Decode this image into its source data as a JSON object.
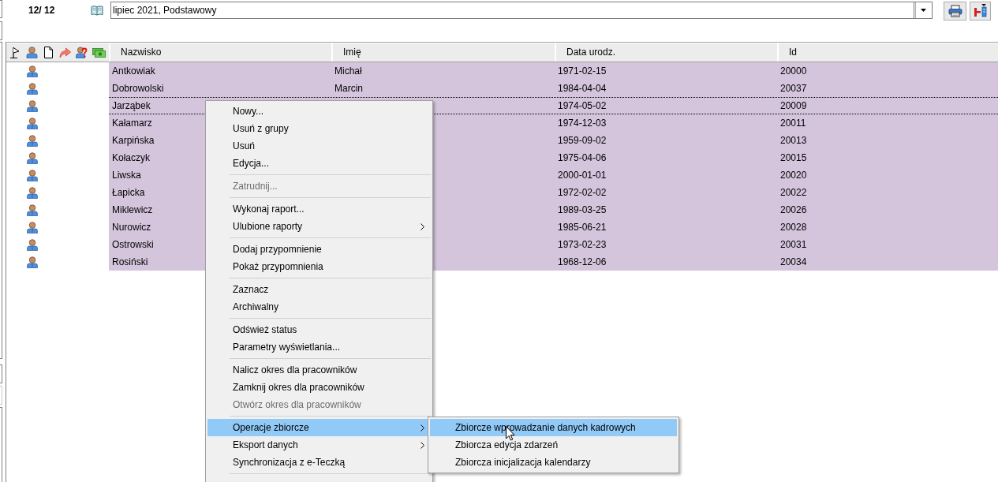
{
  "toolbar": {
    "counter": "12/ 12",
    "period": {
      "value": "lipiec 2021, Podstawowy"
    }
  },
  "table": {
    "columns": [
      "Nazwisko",
      "Imię",
      "Data urodz.",
      "Id"
    ],
    "rows": [
      {
        "last_name": "Antkowiak",
        "first_name": "Michał",
        "birth_date": "1971-02-15",
        "id": "20000",
        "selected": true,
        "focused": false
      },
      {
        "last_name": "Dobrowolski",
        "first_name": "Marcin",
        "birth_date": "1984-04-04",
        "id": "20037",
        "selected": true,
        "focused": false
      },
      {
        "last_name": "Jarząbek",
        "birth_date": "1974-05-02",
        "id": "20009",
        "selected": true,
        "focused": true
      },
      {
        "last_name": "Kałamarz",
        "birth_date": "1974-12-03",
        "id": "20011",
        "selected": true,
        "focused": false
      },
      {
        "last_name": "Karpińska",
        "birth_date": "1959-09-02",
        "id": "20013",
        "selected": true,
        "focused": false
      },
      {
        "last_name": "Kołaczyk",
        "birth_date": "1975-04-06",
        "id": "20015",
        "selected": true,
        "focused": false
      },
      {
        "last_name": "Liwska",
        "birth_date": "2000-01-01",
        "id": "20020",
        "selected": true,
        "focused": false
      },
      {
        "last_name": "Łapicka",
        "birth_date": "1972-02-02",
        "id": "20022",
        "selected": true,
        "focused": false
      },
      {
        "last_name": "Miklewicz",
        "birth_date": "1989-03-25",
        "id": "20026",
        "selected": true,
        "focused": false
      },
      {
        "last_name": "Nurowicz",
        "birth_date": "1985-06-21",
        "id": "20028",
        "selected": true,
        "focused": false
      },
      {
        "last_name": "Ostrowski",
        "birth_date": "1973-02-23",
        "id": "20031",
        "selected": true,
        "focused": false
      },
      {
        "last_name": "Rosiński",
        "birth_date": "1968-12-06",
        "id": "20034",
        "selected": true,
        "focused": false
      }
    ]
  },
  "context_menu": {
    "items": [
      {
        "kind": "item",
        "label": "Nowy...",
        "disabled": false,
        "selected": false,
        "submenu": false
      },
      {
        "kind": "item",
        "label": "Usuń z grupy",
        "disabled": false,
        "selected": false,
        "submenu": false
      },
      {
        "kind": "item",
        "label": "Usuń",
        "disabled": false,
        "selected": false,
        "submenu": false
      },
      {
        "kind": "item",
        "label": "Edycja...",
        "disabled": false,
        "selected": false,
        "submenu": false
      },
      {
        "kind": "separator"
      },
      {
        "kind": "item",
        "label": "Zatrudnij...",
        "disabled": true,
        "selected": false,
        "submenu": false
      },
      {
        "kind": "separator"
      },
      {
        "kind": "item",
        "label": "Wykonaj raport...",
        "disabled": false,
        "selected": false,
        "submenu": false
      },
      {
        "kind": "item",
        "label": "Ulubione raporty",
        "disabled": false,
        "selected": false,
        "submenu": true
      },
      {
        "kind": "separator"
      },
      {
        "kind": "item",
        "label": "Dodaj przypomnienie",
        "disabled": false,
        "selected": false,
        "submenu": false
      },
      {
        "kind": "item",
        "label": "Pokaż przypomnienia",
        "disabled": false,
        "selected": false,
        "submenu": false
      },
      {
        "kind": "separator"
      },
      {
        "kind": "item",
        "label": "Zaznacz",
        "disabled": false,
        "selected": false,
        "submenu": false
      },
      {
        "kind": "item",
        "label": "Archiwalny",
        "disabled": false,
        "selected": false,
        "submenu": false
      },
      {
        "kind": "separator"
      },
      {
        "kind": "item",
        "label": "Odśwież status",
        "disabled": false,
        "selected": false,
        "submenu": false
      },
      {
        "kind": "item",
        "label": "Parametry wyświetlania...",
        "disabled": false,
        "selected": false,
        "submenu": false
      },
      {
        "kind": "separator"
      },
      {
        "kind": "item",
        "label": "Nalicz okres dla pracowników",
        "disabled": false,
        "selected": false,
        "submenu": false
      },
      {
        "kind": "item",
        "label": "Zamknij okres dla pracowników",
        "disabled": false,
        "selected": false,
        "submenu": false
      },
      {
        "kind": "item",
        "label": "Otwórz okres dla pracowników",
        "disabled": true,
        "selected": false,
        "submenu": false
      },
      {
        "kind": "separator"
      },
      {
        "kind": "item",
        "label": "Operacje zbiorcze",
        "disabled": false,
        "selected": true,
        "submenu": true
      },
      {
        "kind": "item",
        "label": "Eksport danych",
        "disabled": false,
        "selected": false,
        "submenu": true
      },
      {
        "kind": "item",
        "label": "Synchronizacja z e-Teczką",
        "disabled": false,
        "selected": false,
        "submenu": false
      },
      {
        "kind": "separator"
      }
    ]
  },
  "submenu": {
    "items": [
      {
        "label": "Zbiorcze wprowadzanie danych kadrowych",
        "selected": true
      },
      {
        "label": "Zbiorcza edycja zdarzeń",
        "selected": false
      },
      {
        "label": "Zbiorcza inicjalizacja kalendarzy",
        "selected": false
      }
    ]
  }
}
